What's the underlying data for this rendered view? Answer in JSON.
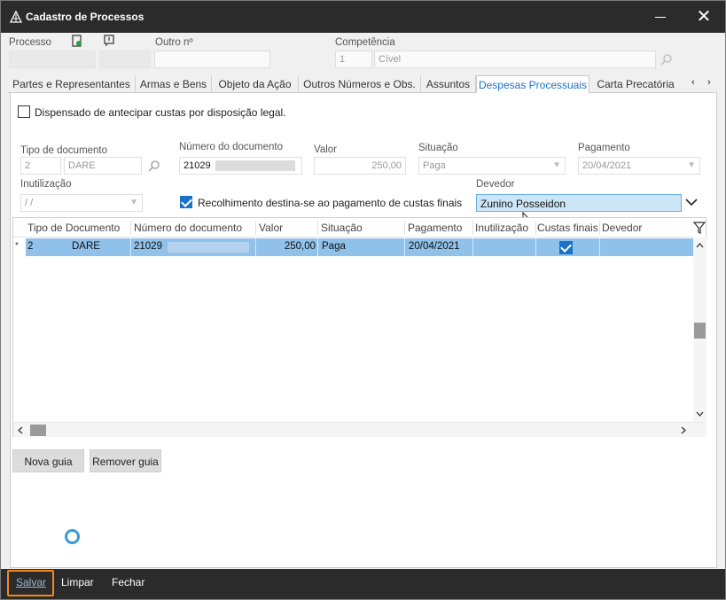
{
  "window": {
    "title": "Cadastro de Processos",
    "close_glyph": "✕"
  },
  "header": {
    "processo_label": "Processo",
    "outro_label": "Outro nº",
    "competencia_label": "Competência",
    "competencia_code": "1",
    "competencia_name": "Cível"
  },
  "tabs": [
    {
      "label": "Partes e Representantes"
    },
    {
      "label": "Armas e Bens"
    },
    {
      "label": "Objeto da Ação"
    },
    {
      "label": "Outros Números e Obs."
    },
    {
      "label": "Assuntos"
    },
    {
      "label": "Despesas Processuais"
    },
    {
      "label": "Carta Precatória"
    }
  ],
  "tab_nav": {
    "prev": "‹",
    "next": "›"
  },
  "form": {
    "dispensado_label": "Dispensado de antecipar custas por disposição legal.",
    "tipo_label": "Tipo de documento",
    "tipo_code": "2",
    "tipo_name": "DARE",
    "numero_label": "Número do documento",
    "numero_value": "21029",
    "valor_label": "Valor",
    "valor_value": "250,00",
    "situacao_label": "Situação",
    "situacao_value": "Paga",
    "pagamento_label": "Pagamento",
    "pagamento_value": "20/04/2021",
    "inutilizacao_label": "Inutilização",
    "inutilizacao_value": "/ /",
    "recolhimento_label": "Recolhimento destina-se ao pagamento de custas finais",
    "devedor_label": "Devedor",
    "devedor_value": "Zunino Posseidon"
  },
  "grid": {
    "columns": [
      "Tipo de Documento",
      "Número do documento",
      "Valor",
      "Situação",
      "Pagamento",
      "Inutilização",
      "Custas finais",
      "Devedor"
    ],
    "rows": [
      {
        "marker": "*",
        "tipo_code": "2",
        "tipo_name": "DARE",
        "numero": "21029",
        "valor": "250,00",
        "situacao": "Paga",
        "pagamento": "20/04/2021",
        "inutilizacao": "",
        "custas_finais": true,
        "devedor": ""
      }
    ]
  },
  "actions": {
    "nova_guia": "Nova guia",
    "remover_guia": "Remover guia"
  },
  "footer": {
    "salvar": "Salvar",
    "limpar": "Limpar",
    "fechar": "Fechar"
  },
  "colors": {
    "titlebar": "#2b2b2b",
    "accent": "#1a73c6",
    "selected_row": "#8fc1ea",
    "highlight_field": "#cde6f7",
    "focus_outline": "#f08a1c"
  }
}
